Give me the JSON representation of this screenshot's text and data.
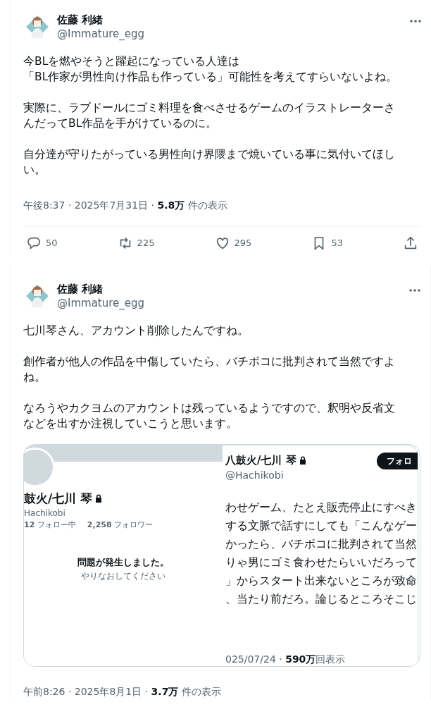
{
  "tweets": [
    {
      "author": {
        "name": "佐藤 利緒",
        "handle": "@Immature_egg"
      },
      "paragraphs": [
        [
          "今BLを燃やそうと躍起になっている人達は",
          "「BL作家が男性向け作品も作っている」可能性を考えてすらいないよね。"
        ],
        [
          "実際に、ラブドールにゴミ料理を食べさせるゲームのイラストレーターさ",
          "んだってBL作品を手がけているのに。"
        ],
        [
          "自分達が守りたがっている男性向け界隈まで焼いている事に気付いてほし",
          "い。"
        ]
      ],
      "meta": "午後8:37 · 2025年7月31日 · **5.8万** 件の表示",
      "actions": [
        {
          "kind": "reply",
          "count": "50"
        },
        {
          "kind": "repost",
          "count": "225"
        },
        {
          "kind": "like",
          "count": "295"
        },
        {
          "kind": "bookmark",
          "count": "53"
        },
        {
          "kind": "share"
        }
      ]
    },
    {
      "author": {
        "name": "佐藤 利緒",
        "handle": "@Immature_egg"
      },
      "paragraphs": [
        [
          "七川琴さん、アカウント削除したんですね。"
        ],
        [
          "創作者が他人の作品を中傷していたら、バチボコに批判されて当然ですよ",
          "ね。"
        ],
        [
          "なろうやカクヨムのアカウントは残っているようですので、釈明や反省文",
          "などを出すか注視していこうと思います。"
        ]
      ],
      "embed": {
        "left": {
          "name": "鼓火/七川 琴",
          "handle": "Hachikobi",
          "stats": [
            "**12** フォロー中",
            "**2,258** フォロワー"
          ],
          "error_title": "問題が発生しました。",
          "error_hint": "やりなおしてください"
        },
        "right": {
          "name": "八鼓火/七川 琴",
          "handle": "@Hachikobi",
          "follow_button": "フォロ",
          "lines": [
            "わせゲーム、たとえ販売停止にすべき",
            "する文脈で話すにしても「こんなゲー",
            "かったら、バチボコに批判されて当然",
            "りゃ男にゴミ食わせたらいいだろって",
            "」からスタート出来ないところが致命",
            "、当たり前だろ。論じるところそこじ"
          ],
          "meta": "025/07/24 · **590万**回表示"
        }
      },
      "meta": "午前8:26 · 2025年8月1日 · **3.7万** 件の表示"
    }
  ]
}
